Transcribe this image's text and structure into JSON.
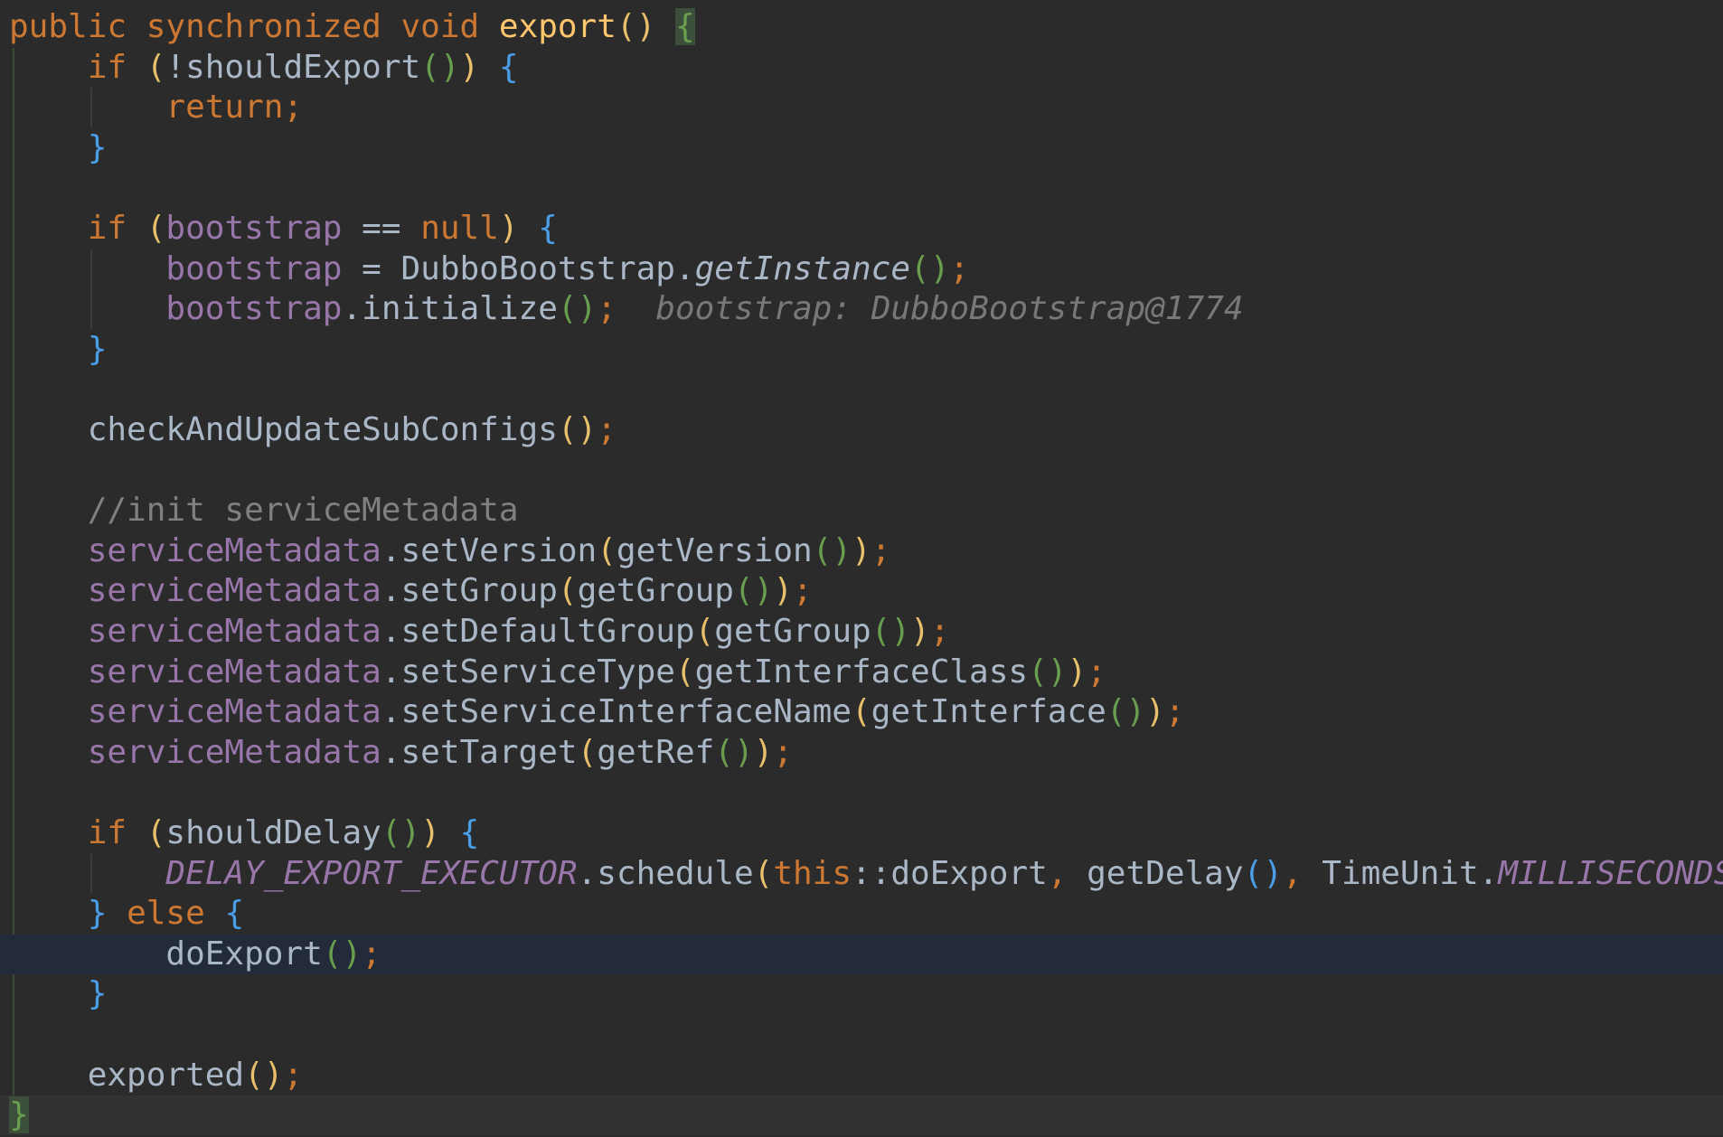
{
  "editor": {
    "lines": [
      [
        {
          "t": "public synchronized void ",
          "c": "kw"
        },
        {
          "t": "export",
          "c": "fn"
        },
        {
          "t": "()",
          "c": "p1"
        },
        {
          "t": " ",
          "c": "txt"
        },
        {
          "t": "{",
          "c": "brace-match"
        }
      ],
      [
        {
          "t": "    if ",
          "c": "kw"
        },
        {
          "t": "(",
          "c": "p1"
        },
        {
          "t": "!shouldExport",
          "c": "txt"
        },
        {
          "t": "()",
          "c": "p2"
        },
        {
          "t": ")",
          "c": "p1"
        },
        {
          "t": " ",
          "c": "txt"
        },
        {
          "t": "{",
          "c": "p3"
        }
      ],
      [
        {
          "t": "        return;",
          "c": "kw"
        }
      ],
      [
        {
          "t": "    ",
          "c": "txt"
        },
        {
          "t": "}",
          "c": "p3"
        }
      ],
      [],
      [
        {
          "t": "    if ",
          "c": "kw"
        },
        {
          "t": "(",
          "c": "p1"
        },
        {
          "t": "bootstrap",
          "c": "fld"
        },
        {
          "t": " == ",
          "c": "txt"
        },
        {
          "t": "null",
          "c": "kw"
        },
        {
          "t": ")",
          "c": "p1"
        },
        {
          "t": " ",
          "c": "txt"
        },
        {
          "t": "{",
          "c": "p3"
        }
      ],
      [
        {
          "t": "        ",
          "c": "txt"
        },
        {
          "t": "bootstrap",
          "c": "fld"
        },
        {
          "t": " = DubboBootstrap.",
          "c": "txt"
        },
        {
          "t": "getInstance",
          "c": "static-call"
        },
        {
          "t": "()",
          "c": "p2"
        },
        {
          "t": ";",
          "c": "semi"
        }
      ],
      [
        {
          "t": "        ",
          "c": "txt"
        },
        {
          "t": "bootstrap",
          "c": "fld"
        },
        {
          "t": ".initialize",
          "c": "txt"
        },
        {
          "t": "()",
          "c": "p2"
        },
        {
          "t": ";",
          "c": "semi"
        },
        {
          "t": "  bootstrap: DubboBootstrap@1774",
          "c": "inlay"
        }
      ],
      [
        {
          "t": "    ",
          "c": "txt"
        },
        {
          "t": "}",
          "c": "p3"
        }
      ],
      [],
      [
        {
          "t": "    checkAndUpdateSubConfigs",
          "c": "txt"
        },
        {
          "t": "()",
          "c": "p1"
        },
        {
          "t": ";",
          "c": "semi"
        }
      ],
      [],
      [
        {
          "t": "    //init serviceMetadata",
          "c": "cmt"
        }
      ],
      [
        {
          "t": "    ",
          "c": "txt"
        },
        {
          "t": "serviceMetadata",
          "c": "fld"
        },
        {
          "t": ".setVersion",
          "c": "txt"
        },
        {
          "t": "(",
          "c": "p1"
        },
        {
          "t": "getVersion",
          "c": "txt"
        },
        {
          "t": "()",
          "c": "p2"
        },
        {
          "t": ")",
          "c": "p1"
        },
        {
          "t": ";",
          "c": "semi"
        }
      ],
      [
        {
          "t": "    ",
          "c": "txt"
        },
        {
          "t": "serviceMetadata",
          "c": "fld"
        },
        {
          "t": ".setGroup",
          "c": "txt"
        },
        {
          "t": "(",
          "c": "p1"
        },
        {
          "t": "getGroup",
          "c": "txt"
        },
        {
          "t": "()",
          "c": "p2"
        },
        {
          "t": ")",
          "c": "p1"
        },
        {
          "t": ";",
          "c": "semi"
        }
      ],
      [
        {
          "t": "    ",
          "c": "txt"
        },
        {
          "t": "serviceMetadata",
          "c": "fld"
        },
        {
          "t": ".setDefaultGroup",
          "c": "txt"
        },
        {
          "t": "(",
          "c": "p1"
        },
        {
          "t": "getGroup",
          "c": "txt"
        },
        {
          "t": "()",
          "c": "p2"
        },
        {
          "t": ")",
          "c": "p1"
        },
        {
          "t": ";",
          "c": "semi"
        }
      ],
      [
        {
          "t": "    ",
          "c": "txt"
        },
        {
          "t": "serviceMetadata",
          "c": "fld"
        },
        {
          "t": ".setServiceType",
          "c": "txt"
        },
        {
          "t": "(",
          "c": "p1"
        },
        {
          "t": "getInterfaceClass",
          "c": "txt"
        },
        {
          "t": "()",
          "c": "p2"
        },
        {
          "t": ")",
          "c": "p1"
        },
        {
          "t": ";",
          "c": "semi"
        }
      ],
      [
        {
          "t": "    ",
          "c": "txt"
        },
        {
          "t": "serviceMetadata",
          "c": "fld"
        },
        {
          "t": ".setServiceInterfaceName",
          "c": "txt"
        },
        {
          "t": "(",
          "c": "p1"
        },
        {
          "t": "getInterface",
          "c": "txt"
        },
        {
          "t": "()",
          "c": "p2"
        },
        {
          "t": ")",
          "c": "p1"
        },
        {
          "t": ";",
          "c": "semi"
        }
      ],
      [
        {
          "t": "    ",
          "c": "txt"
        },
        {
          "t": "serviceMetadata",
          "c": "fld"
        },
        {
          "t": ".setTarget",
          "c": "txt"
        },
        {
          "t": "(",
          "c": "p1"
        },
        {
          "t": "getRef",
          "c": "txt"
        },
        {
          "t": "()",
          "c": "p2"
        },
        {
          "t": ")",
          "c": "p1"
        },
        {
          "t": ";",
          "c": "semi"
        }
      ],
      [],
      [
        {
          "t": "    if ",
          "c": "kw"
        },
        {
          "t": "(",
          "c": "p1"
        },
        {
          "t": "shouldDelay",
          "c": "txt"
        },
        {
          "t": "()",
          "c": "p2"
        },
        {
          "t": ")",
          "c": "p1"
        },
        {
          "t": " ",
          "c": "txt"
        },
        {
          "t": "{",
          "c": "p3"
        }
      ],
      [
        {
          "t": "        ",
          "c": "txt"
        },
        {
          "t": "DELAY_EXPORT_EXECUTOR",
          "c": "fld-static"
        },
        {
          "t": ".schedule",
          "c": "txt"
        },
        {
          "t": "(",
          "c": "p1"
        },
        {
          "t": "this",
          "c": "kw"
        },
        {
          "t": "::doExport",
          "c": "txt"
        },
        {
          "t": ", ",
          "c": "semi"
        },
        {
          "t": "getDelay",
          "c": "txt"
        },
        {
          "t": "()",
          "c": "p3"
        },
        {
          "t": ", ",
          "c": "semi"
        },
        {
          "t": "TimeUnit.",
          "c": "txt"
        },
        {
          "t": "MILLISECONDS",
          "c": "fld-static"
        },
        {
          "t": ")",
          "c": "p1"
        },
        {
          "t": ";",
          "c": "semi"
        }
      ],
      [
        {
          "t": "    ",
          "c": "txt"
        },
        {
          "t": "}",
          "c": "p3"
        },
        {
          "t": " else ",
          "c": "kw"
        },
        {
          "t": "{",
          "c": "p3"
        }
      ],
      [
        {
          "t": "        doExport",
          "c": "txt"
        },
        {
          "t": "()",
          "c": "p2"
        },
        {
          "t": ";",
          "c": "semi"
        }
      ],
      [
        {
          "t": "    ",
          "c": "txt"
        },
        {
          "t": "}",
          "c": "p3"
        }
      ],
      [],
      [
        {
          "t": "    exported",
          "c": "txt"
        },
        {
          "t": "()",
          "c": "p1"
        },
        {
          "t": ";",
          "c": "semi"
        }
      ],
      [
        {
          "t": "}",
          "c": "brace-match"
        }
      ]
    ],
    "current_line_index": 23,
    "colors": {
      "background": "#2b2b2b",
      "current_line": "#232a3a",
      "keyword": "#cc7832",
      "method_decl": "#ffc66d",
      "field": "#9876aa",
      "comment": "#808080",
      "default_text": "#a9b7c6",
      "paren_level1": "#e8bf6a",
      "paren_level2": "#6a9e4f",
      "paren_level3": "#4a9ee8"
    }
  }
}
